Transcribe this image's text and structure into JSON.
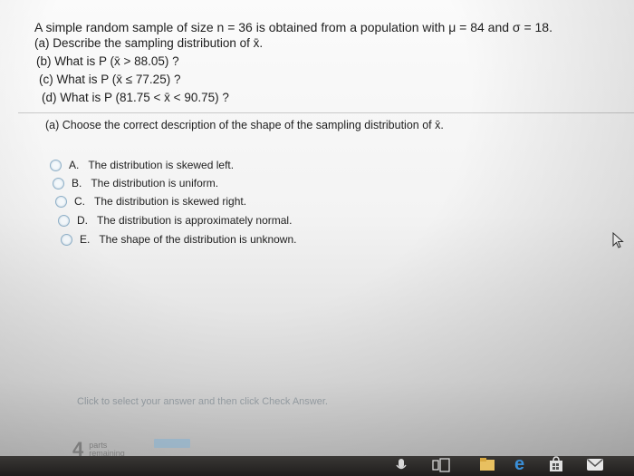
{
  "question": {
    "line1": "A simple random sample of size n = 36 is obtained from a population with μ = 84 and σ = 18.",
    "part_a": "(a) Describe the sampling distribution of x̄.",
    "part_b": "(b) What is P (x̄ > 88.05) ?",
    "part_c": "(c) What is P (x̄ ≤ 77.25) ?",
    "part_d": "(d) What is P (81.75 < x̄ < 90.75) ?"
  },
  "prompt": "(a) Choose the correct description of the shape of the sampling distribution of x̄.",
  "options": [
    {
      "letter": "A.",
      "text": "The distribution is skewed left."
    },
    {
      "letter": "B.",
      "text": "The distribution is uniform."
    },
    {
      "letter": "C.",
      "text": "The distribution is skewed right."
    },
    {
      "letter": "D.",
      "text": "The distribution is approximately normal."
    },
    {
      "letter": "E.",
      "text": "The shape of the distribution is unknown."
    }
  ],
  "hint": "Click to select your answer and then click Check Answer.",
  "parts": {
    "count": "4",
    "label_line1": "parts",
    "label_line2": "remaining"
  },
  "colors": {
    "radio_border": "#8fb0c8",
    "progress": "#a8c4d8",
    "taskbar": "#2a2827"
  },
  "icons": [
    "cursor-arrow-icon",
    "mic-icon",
    "task-view-icon",
    "folder-icon",
    "edge-icon",
    "store-icon",
    "mail-icon"
  ]
}
